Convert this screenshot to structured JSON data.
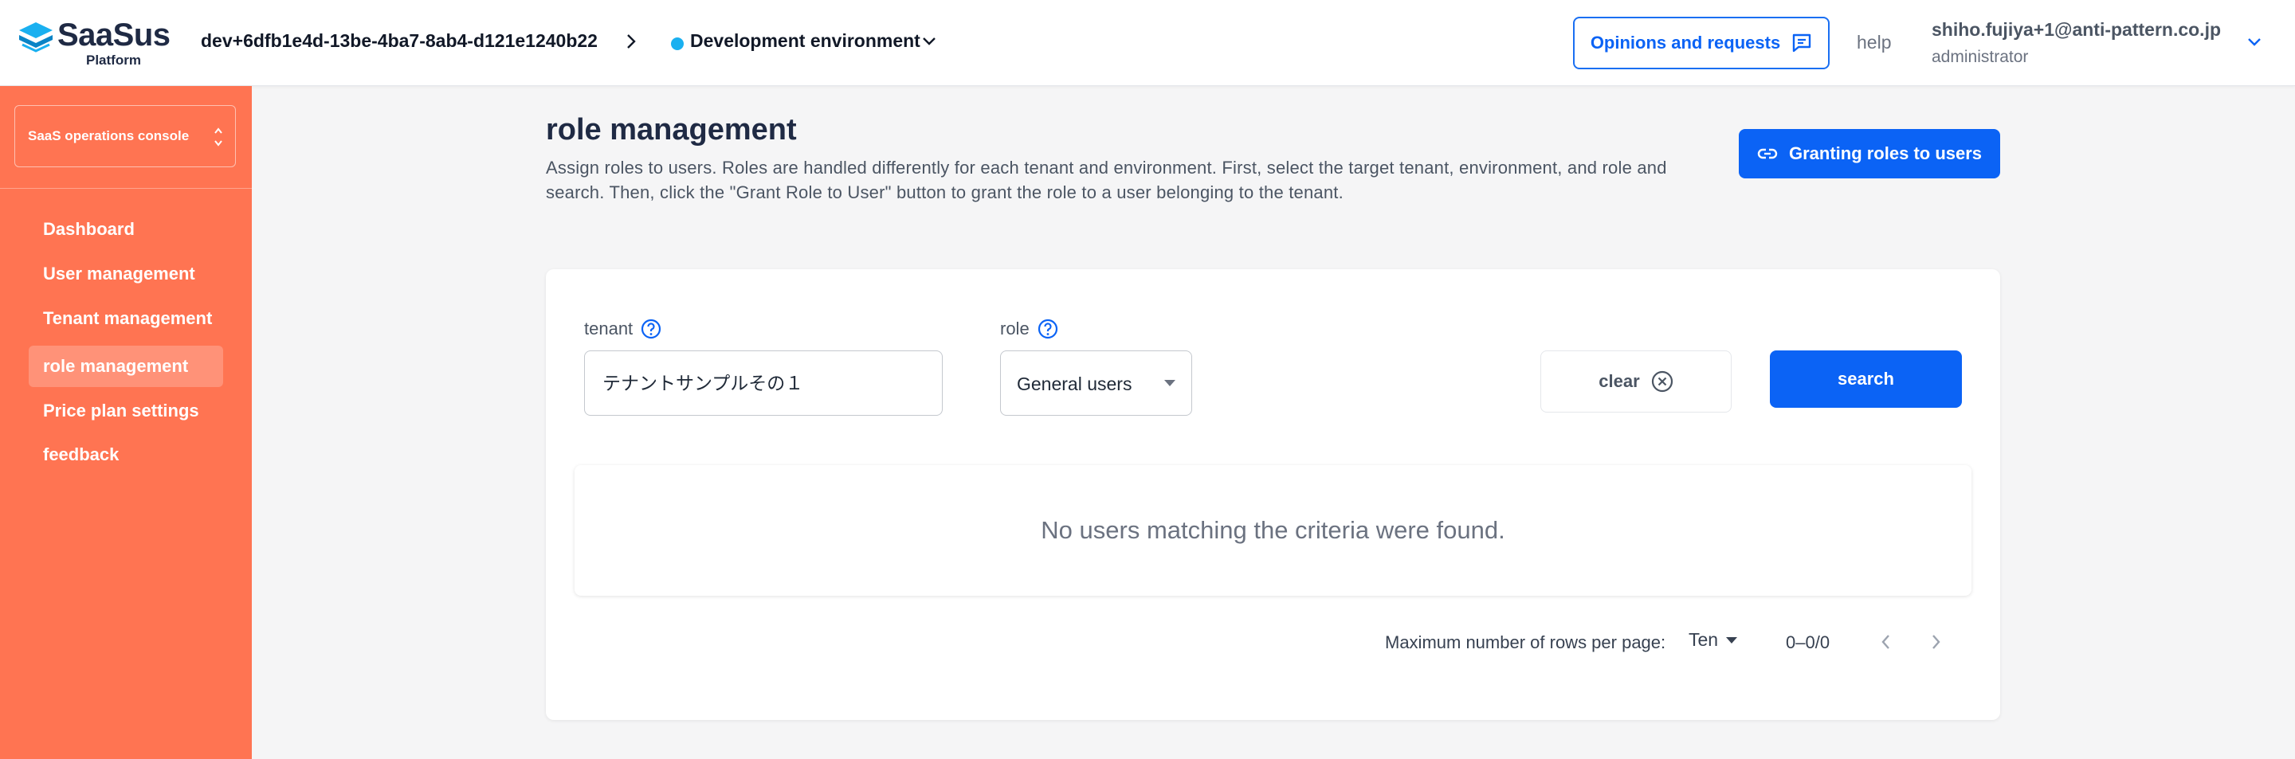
{
  "header": {
    "logo_text": "SaaSus",
    "logo_sub": "Platform",
    "env_id": "dev+6dfb1e4d-13be-4ba7-8ab4-d121e1240b22",
    "env_name": "Development environment",
    "env_dot_color": "#1ab0f0",
    "opinions_label": "Opinions and requests",
    "help_label": "help",
    "user_email": "shiho.fujiya+1@anti-pattern.co.jp",
    "user_role": "administrator"
  },
  "sidebar": {
    "console_label": "SaaS operations console",
    "items": [
      {
        "label": "Dashboard",
        "active": false
      },
      {
        "label": "User management",
        "active": false
      },
      {
        "label": "Tenant management",
        "active": false
      },
      {
        "label": "role management",
        "active": true
      },
      {
        "label": "Price plan settings",
        "active": false
      },
      {
        "label": "feedback",
        "active": false
      }
    ]
  },
  "main": {
    "title": "role management",
    "description": "Assign roles to users. Roles are handled differently for each tenant and environment. First, select the target tenant, environment, and role and search. Then, click the \"Grant Role to User\" button to grant the role to a user belonging to the tenant.",
    "grant_button_label": "Granting roles to users",
    "filters": {
      "tenant_label": "tenant",
      "tenant_value": "テナントサンプルその１",
      "role_label": "role",
      "role_value": "General users",
      "clear_label": "clear",
      "search_label": "search"
    },
    "empty_message": "No users matching the criteria were found.",
    "pagination": {
      "rows_label": "Maximum number of rows per page:",
      "rows_value": "Ten",
      "range": "0–0/0"
    }
  },
  "colors": {
    "accent": "#ff7452",
    "primary": "#0b63f5"
  }
}
